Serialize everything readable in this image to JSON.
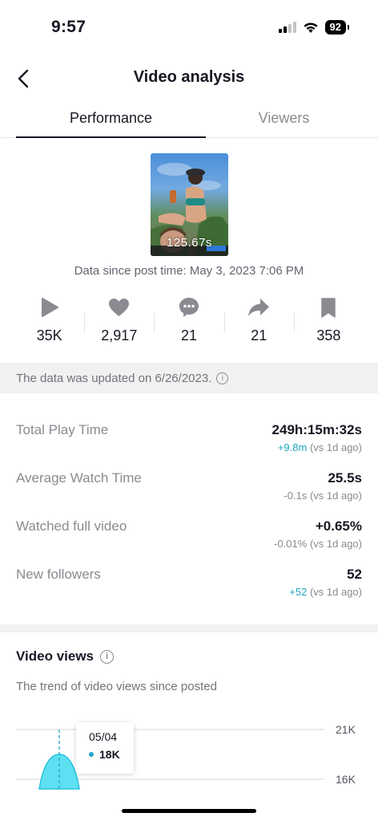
{
  "status_bar": {
    "time": "9:57",
    "battery": "92"
  },
  "header": {
    "title": "Video analysis"
  },
  "tabs": [
    {
      "label": "Performance"
    },
    {
      "label": "Viewers"
    }
  ],
  "video": {
    "caption": "125.67s"
  },
  "data_since": "Data since post time: May 3, 2023 7:06 PM",
  "stats": [
    {
      "icon": "play-icon",
      "value": "35K"
    },
    {
      "icon": "heart-icon",
      "value": "2,917"
    },
    {
      "icon": "comment-icon",
      "value": "21"
    },
    {
      "icon": "share-icon",
      "value": "21"
    },
    {
      "icon": "bookmark-icon",
      "value": "358"
    }
  ],
  "updated_text": "The data was updated on 6/26/2023.",
  "metrics": [
    {
      "label": "Total Play Time",
      "value": "249h:15m:32s",
      "delta": "+9.8m",
      "suffix": "(vs 1d ago)"
    },
    {
      "label": "Average Watch Time",
      "value": "25.5s",
      "delta": "-0.1s",
      "suffix": "(vs 1d ago)"
    },
    {
      "label": "Watched full video",
      "value": "+0.65%",
      "delta": "-0.01%",
      "suffix": "(vs 1d ago)"
    },
    {
      "label": "New followers",
      "value": "52",
      "delta": "+52",
      "suffix": "(vs 1d ago)"
    }
  ],
  "video_views": {
    "title": "Video views",
    "subtitle": "The trend of video views since posted",
    "tooltip": {
      "date": "05/04",
      "value": "18K"
    }
  },
  "colors": {
    "accent": "#20a5b8",
    "chart_fill": "#5ee0f2",
    "chart_stroke": "#20c4dc"
  },
  "chart_data": {
    "type": "area",
    "title": "Video views",
    "y_ticks": [
      "21K",
      "16K"
    ],
    "points": [
      {
        "x": "05/04",
        "y": 18000
      }
    ]
  }
}
